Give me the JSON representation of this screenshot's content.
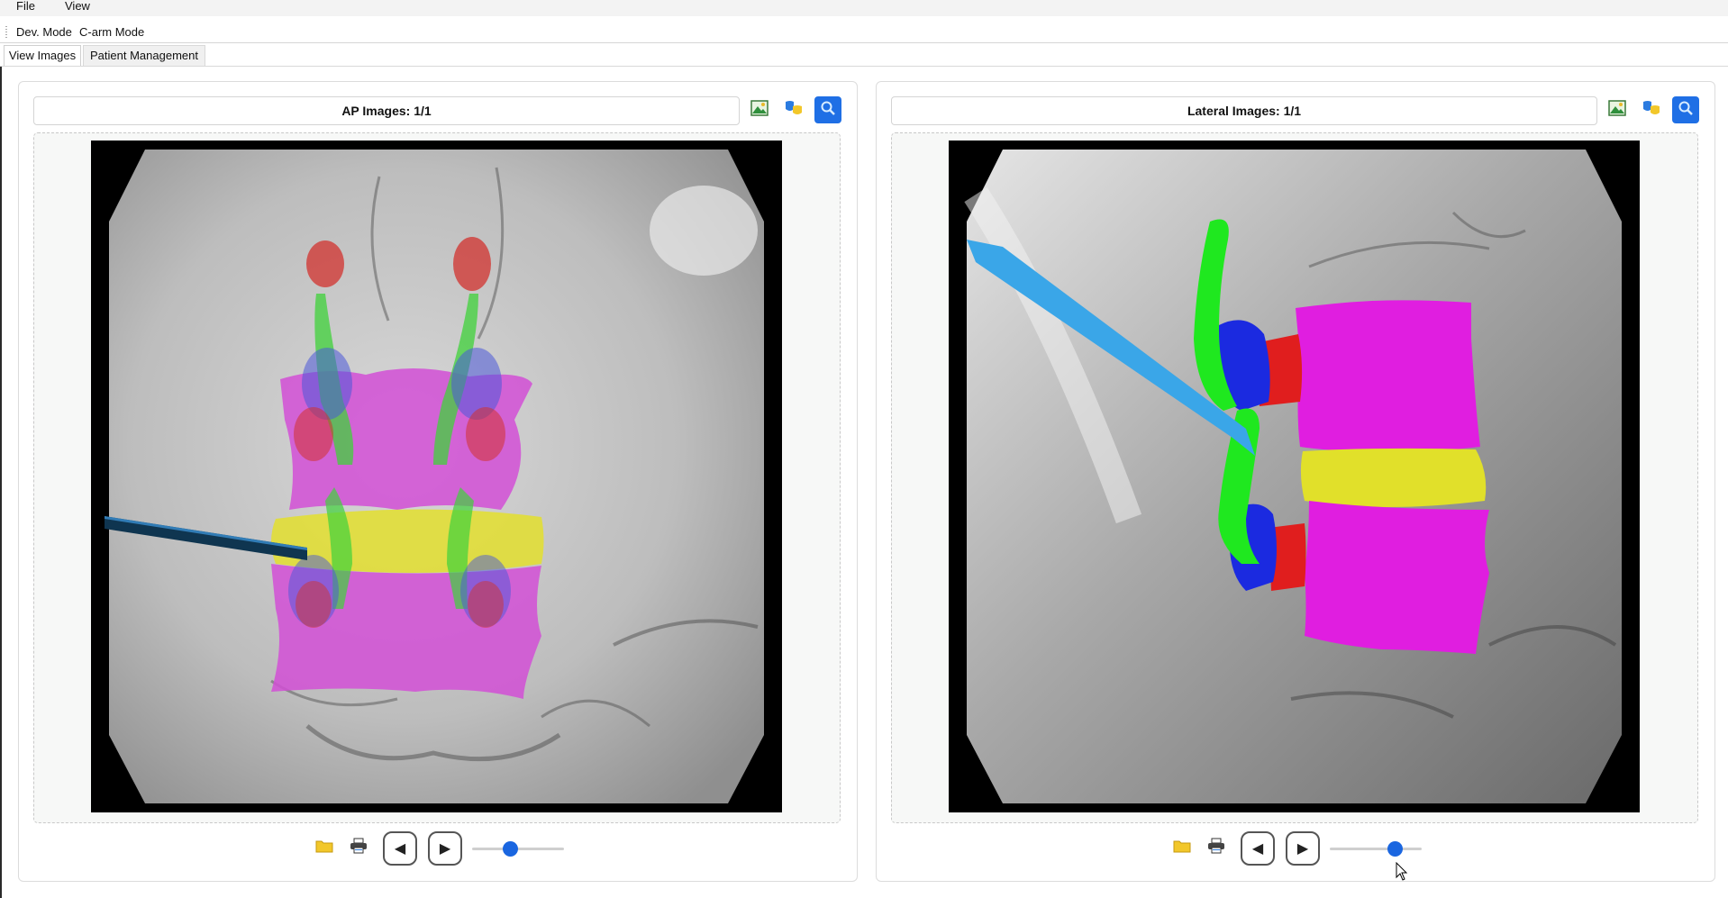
{
  "menu": {
    "file": "File",
    "view": "View"
  },
  "toolbar": {
    "dev_mode": "Dev. Mode",
    "carm_mode": "C-arm Mode"
  },
  "tabs": {
    "view_images": "View Images",
    "patient_management": "Patient Management"
  },
  "ap_panel": {
    "title": "AP Images: 1/1",
    "slider_value": 0.4
  },
  "lateral_panel": {
    "title": "Lateral Images: 1/1",
    "slider_value": 0.75
  },
  "colors": {
    "accent": "#1f6fe5",
    "folder": "#f2c72a"
  },
  "icons": [
    "image-icon",
    "mask-icon",
    "zoom-icon",
    "folder-icon",
    "print-icon",
    "prev-icon",
    "next-icon"
  ]
}
